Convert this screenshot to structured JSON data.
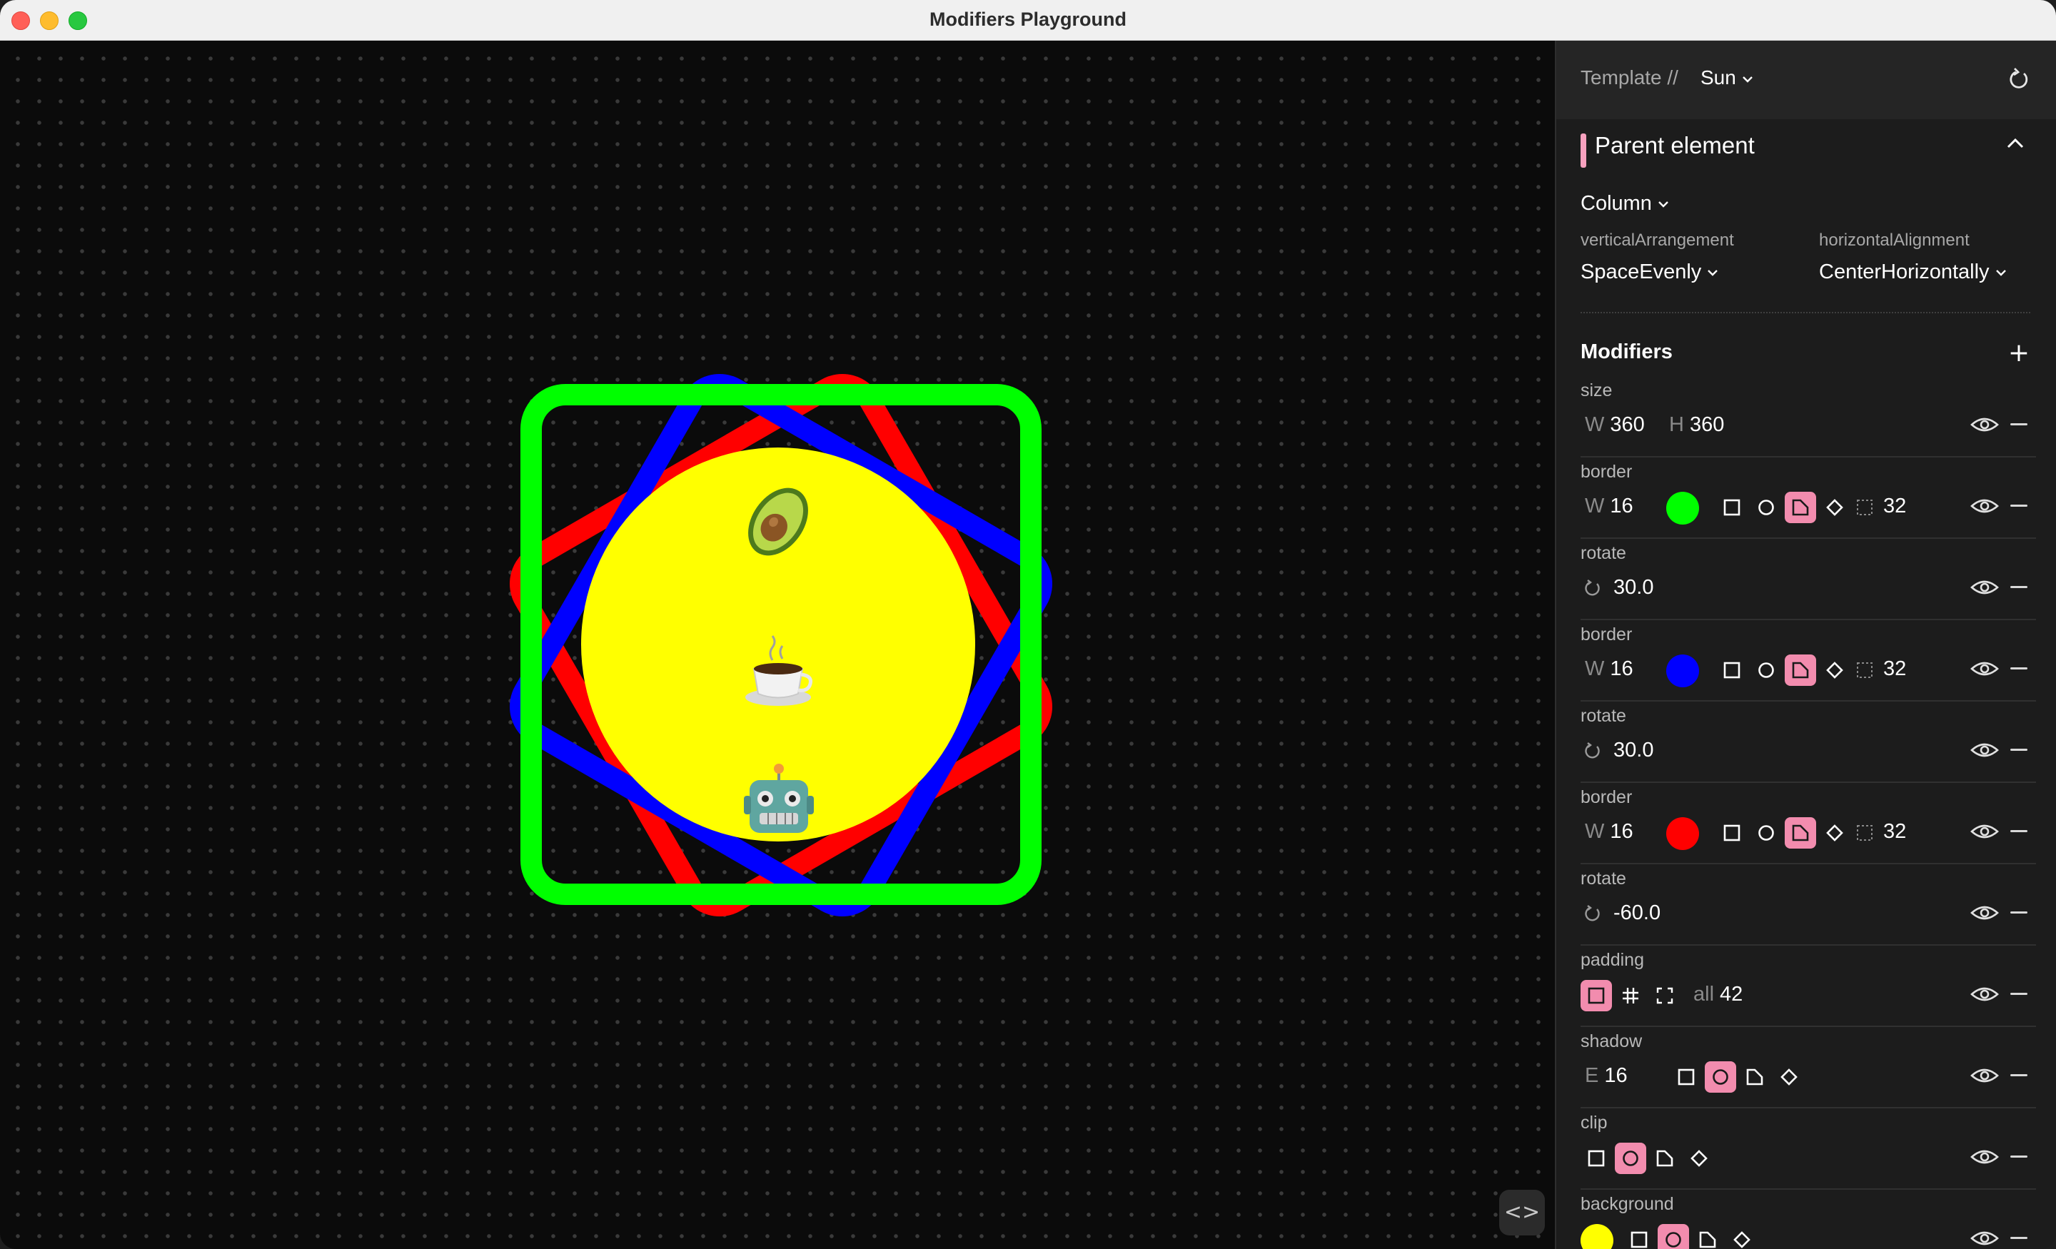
{
  "window": {
    "title": "Modifiers Playground"
  },
  "canvas": {
    "emojis": [
      "avocado",
      "hot-beverage",
      "robot"
    ],
    "colors": {
      "sun": "#ffff00",
      "green": "#00ff00",
      "blue": "#0000ff",
      "red": "#ff0000"
    }
  },
  "panel": {
    "template_label": "Template //",
    "template_value": "Sun",
    "parent_title": "Parent element",
    "layout": "Column",
    "vertical_label": "verticalArrangement",
    "vertical_value": "SpaceEvenly",
    "horizontal_label": "horizontalAlignment",
    "horizontal_value": "CenterHorizontally",
    "modifiers_title": "Modifiers",
    "accent": "#f28cae"
  },
  "modifiers": [
    {
      "name": "size",
      "w_key": "W",
      "w": "360",
      "h_key": "H",
      "h": "360"
    },
    {
      "name": "border",
      "w_key": "W",
      "w": "16",
      "color": "#00ff00",
      "radius": "32",
      "selected_shape": "cut-corner"
    },
    {
      "name": "rotate",
      "value": "30.0"
    },
    {
      "name": "border",
      "w_key": "W",
      "w": "16",
      "color": "#0000ff",
      "radius": "32",
      "selected_shape": "cut-corner"
    },
    {
      "name": "rotate",
      "value": "30.0"
    },
    {
      "name": "border",
      "w_key": "W",
      "w": "16",
      "color": "#ff0000",
      "radius": "32",
      "selected_shape": "cut-corner"
    },
    {
      "name": "rotate",
      "value": "-60.0"
    },
    {
      "name": "padding",
      "selected_mode": "all",
      "all_key": "all",
      "all": "42"
    },
    {
      "name": "shadow",
      "e_key": "E",
      "e": "16",
      "selected_shape": "circle"
    },
    {
      "name": "clip",
      "selected_shape": "circle"
    },
    {
      "name": "background",
      "color": "#ffff00",
      "selected_shape": "circle"
    }
  ]
}
